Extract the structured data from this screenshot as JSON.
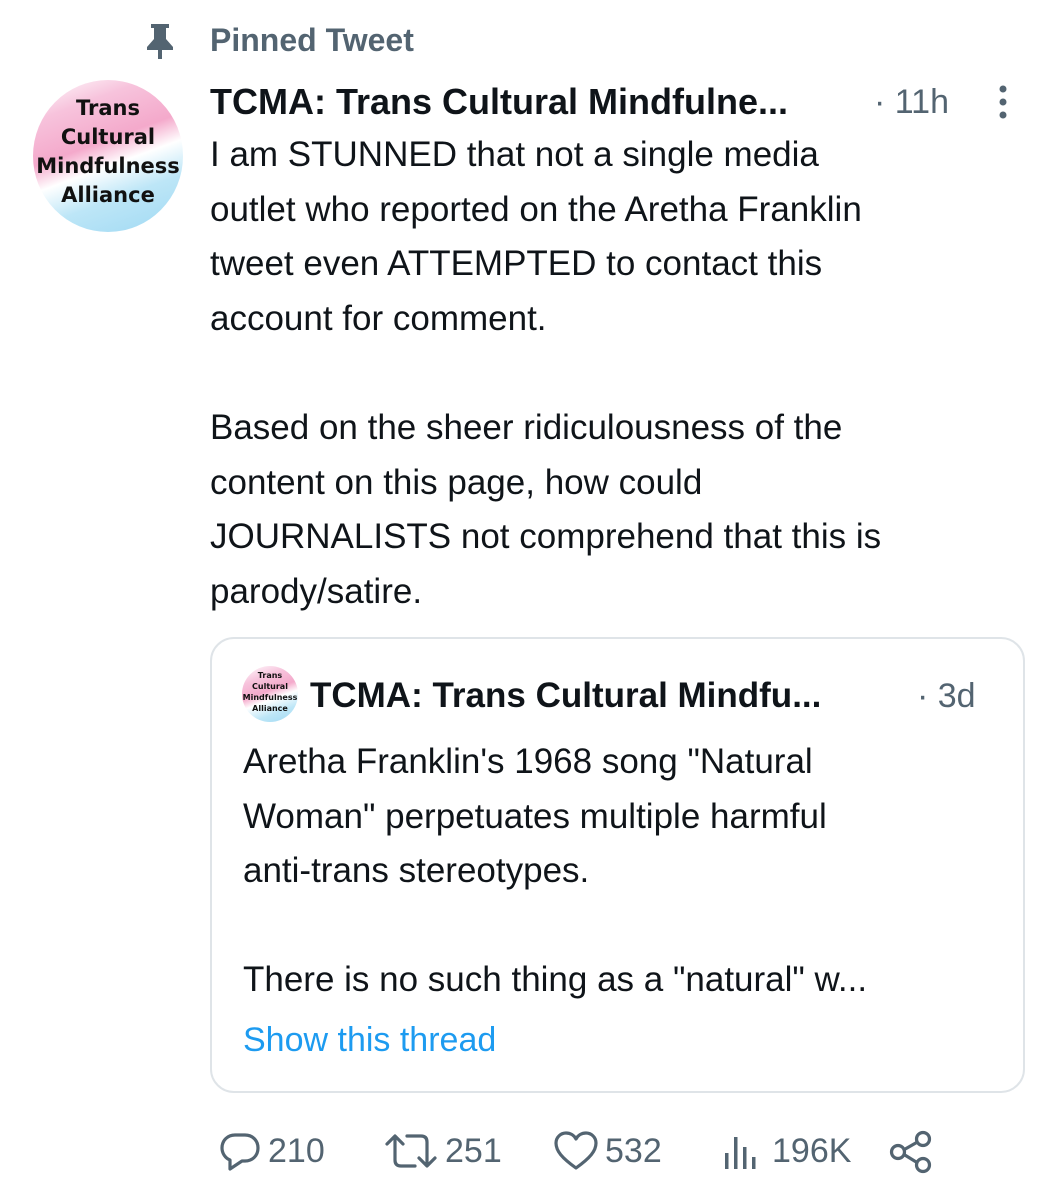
{
  "pinned": {
    "label": "Pinned Tweet"
  },
  "tweet": {
    "avatar_text": "Trans\nCultural\nMindfulness\nAlliance",
    "author": "TCMA: Trans Cultural Mindfulne...",
    "time": "· 11h",
    "text": "I am STUNNED that not a single media\noutlet who reported on the Aretha Franklin\ntweet even ATTEMPTED to contact this\naccount for comment.\n\nBased on the sheer ridiculousness of the\ncontent on this page, how could\nJOURNALISTS not comprehend that this is\nparody/satire."
  },
  "quote": {
    "avatar_text": "Trans\nCultural\nMindfulness\nAlliance",
    "author": "TCMA: Trans Cultural Mindfu...",
    "time": "· 3d",
    "text": "Aretha Franklin's 1968 song \"Natural\nWoman\" perpetuates multiple harmful\nanti-trans stereotypes.\n\nThere is no such thing as a \"natural\" w...",
    "show_thread": "Show this thread"
  },
  "actions": {
    "replies": "210",
    "retweets": "251",
    "likes": "532",
    "views": "196K"
  },
  "icons": [
    "pin-icon",
    "more-icon",
    "reply-icon",
    "retweet-icon",
    "like-icon",
    "views-icon",
    "share-icon"
  ],
  "colors": {
    "muted": "#536471",
    "link": "#1d9bf0",
    "text": "#0f1419",
    "border": "#dfe4e8"
  }
}
